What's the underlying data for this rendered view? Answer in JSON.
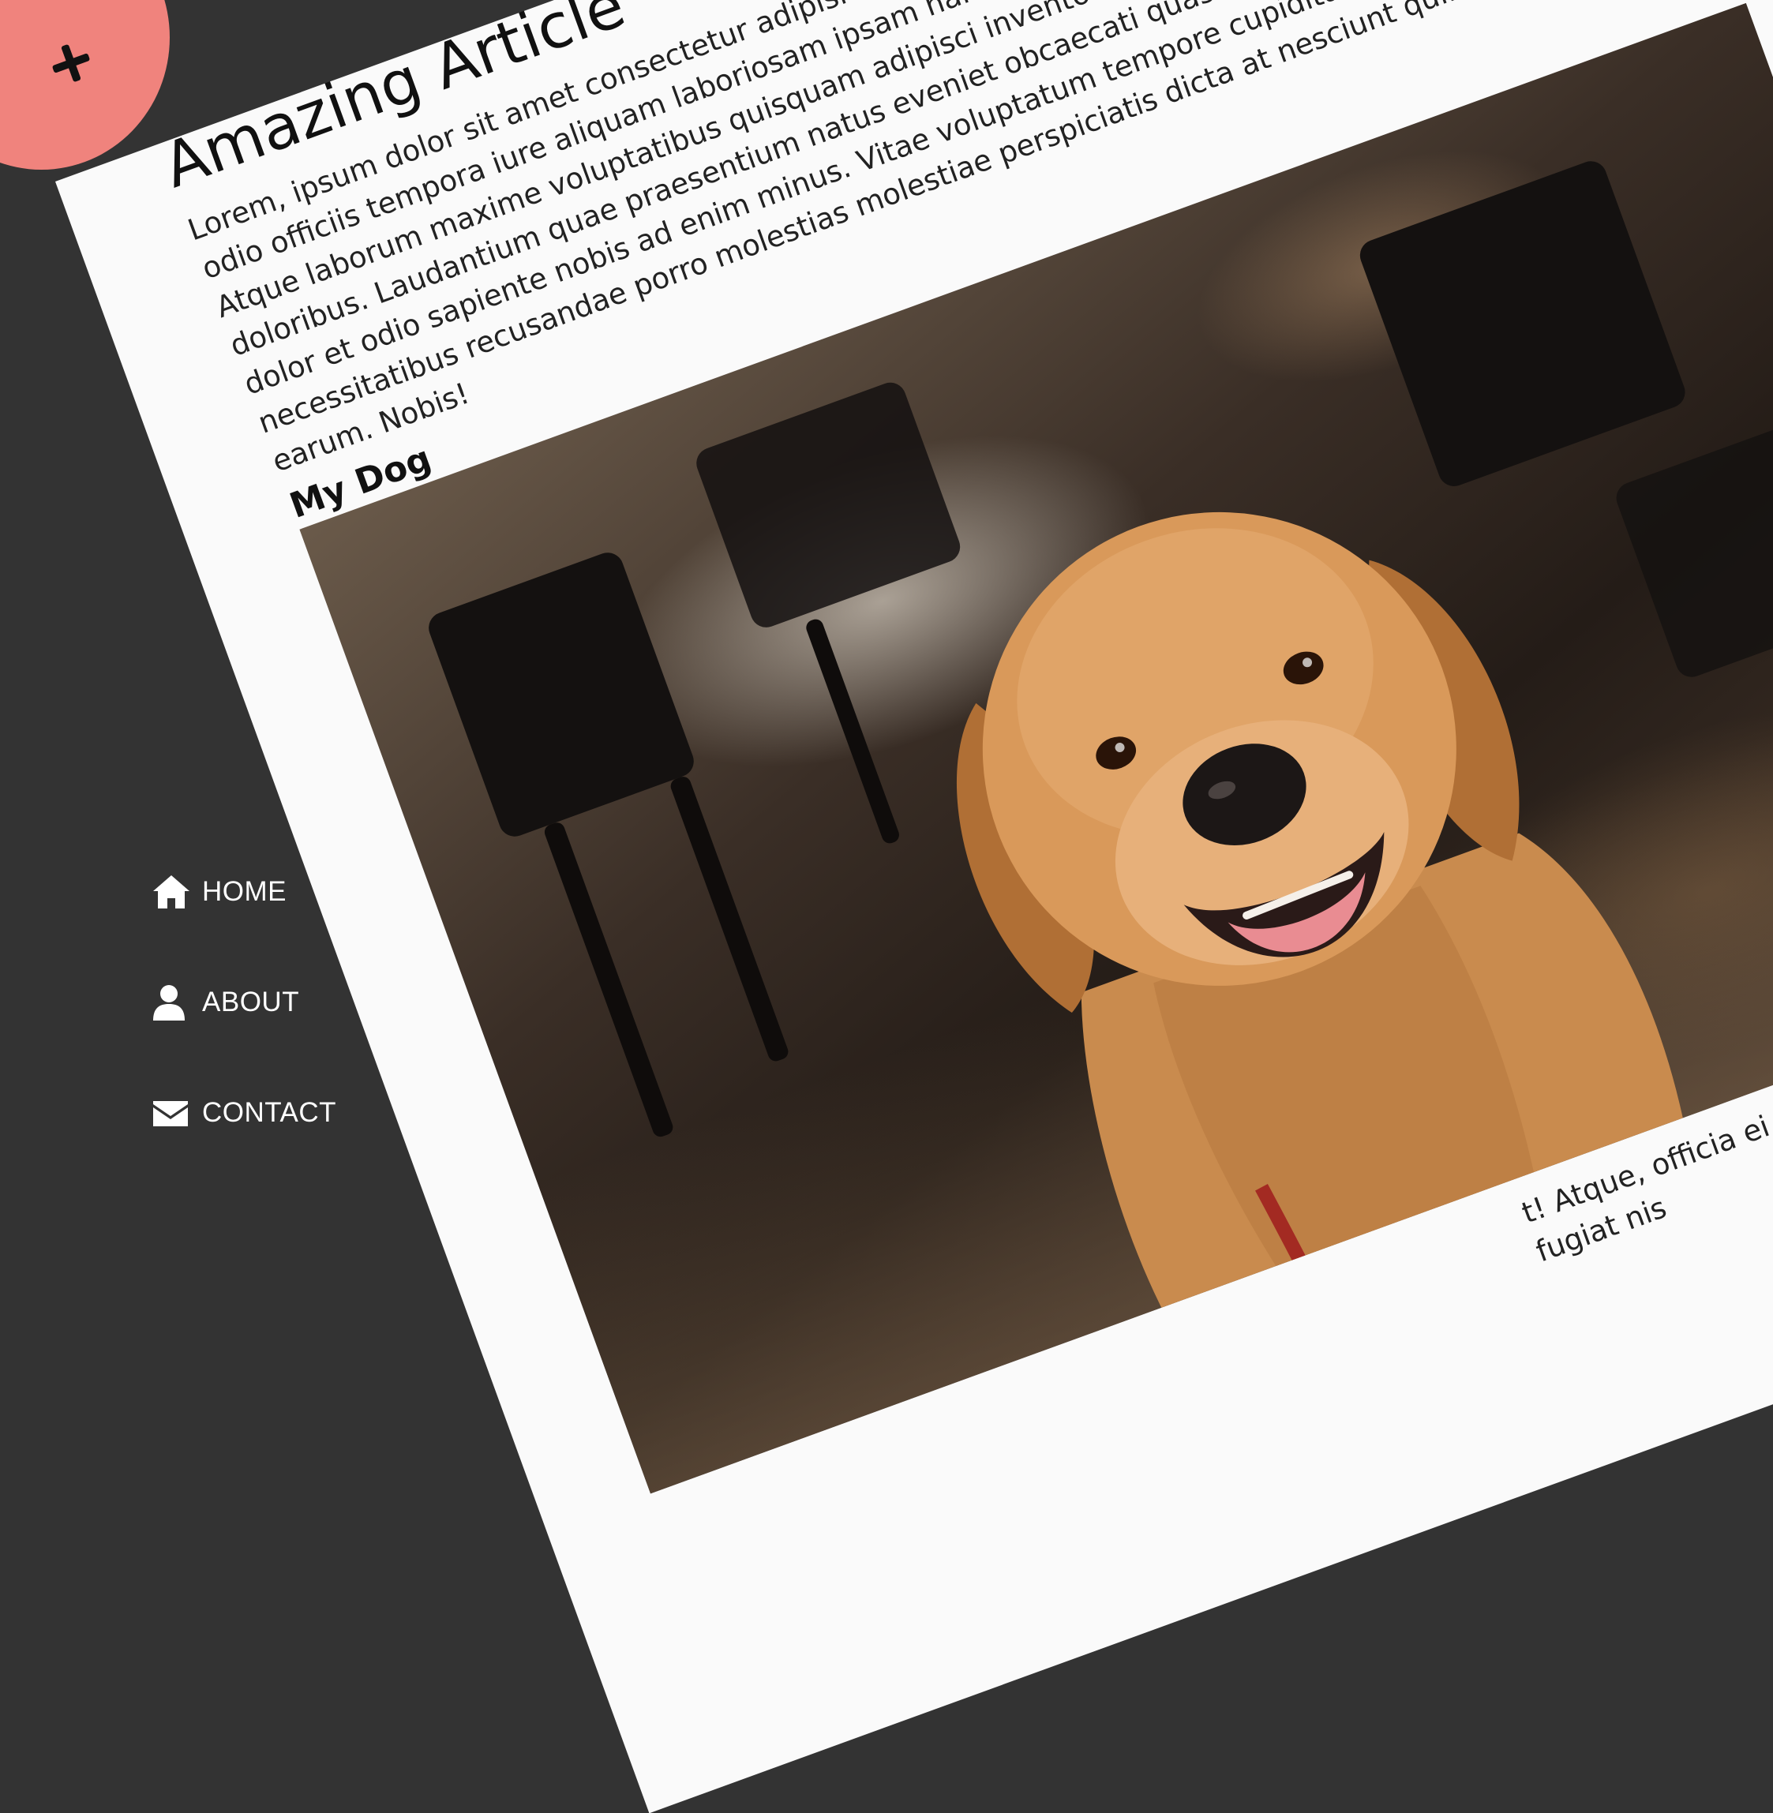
{
  "article": {
    "title": "Amazing Article",
    "body": "Lorem, ipsum dolor sit amet consectetur adipisicing elit. Sit quibusdam illo amet tenetur fuga unde odio officiis tempora iure aliquam laboriosam ipsam harum necessitatibus deserunt voluptatibus. Atque laborum maxime voluptatibus quisquam adipisci inventore dolor repellendus architecto facere doloribus. Laudantium quae praesentium natus eveniet obcaecati quasi, consectetur earum nemo dolor et odio sapiente nobis ad enim minus. Vitae voluptatum tempore cupiditate praesentium necessitatibus recusandae porro molestias molestiae perspiciatis dicta at nesciunt quibusdam, earum. Nobis!",
    "subtitle": "My Dog",
    "image_alt": "golden retriever smiling in a cafe",
    "footer_text": "t! Atque, officia ei",
    "footer_text_2": "fugiat nis"
  },
  "close_button": {
    "icon": "close-icon",
    "color": "#f0837d"
  },
  "nav": {
    "items": [
      {
        "label": "HOME",
        "icon": "home-icon"
      },
      {
        "label": "ABOUT",
        "icon": "user-icon"
      },
      {
        "label": "CONTACT",
        "icon": "envelope-icon"
      }
    ]
  },
  "colors": {
    "sidebar": "#333333",
    "page": "#fafafa",
    "accent": "#f0837d"
  }
}
